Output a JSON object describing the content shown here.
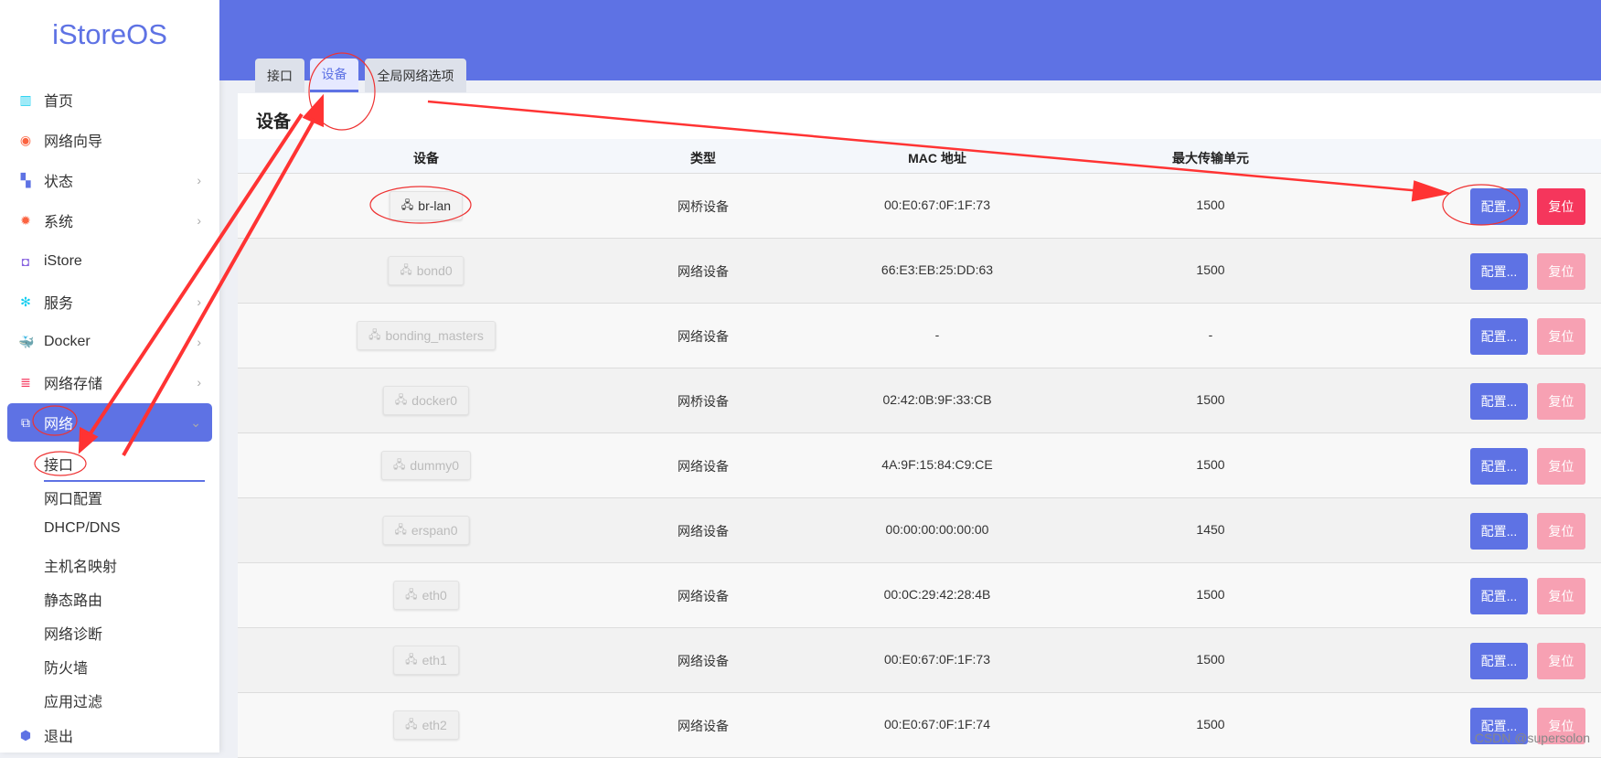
{
  "app": {
    "logo": "iStoreOS",
    "watermark": "CSDN @supersolon"
  },
  "sidebar": {
    "items": [
      {
        "label": "首页",
        "icon": "dashboard-icon",
        "chev": false
      },
      {
        "label": "网络向导",
        "icon": "globe-icon",
        "chev": false
      },
      {
        "label": "状态",
        "icon": "grid-icon",
        "chev": true
      },
      {
        "label": "系统",
        "icon": "gear-icon",
        "chev": true
      },
      {
        "label": "iStore",
        "icon": "bag-icon",
        "chev": false
      },
      {
        "label": "服务",
        "icon": "cogs-icon",
        "chev": true
      },
      {
        "label": "Docker",
        "icon": "docker-icon",
        "chev": true
      },
      {
        "label": "网络存储",
        "icon": "database-icon",
        "chev": true
      },
      {
        "label": "网络",
        "icon": "sitemap-icon",
        "chev": true
      }
    ],
    "subitems": [
      "接口",
      "网口配置",
      "DHCP/DNS",
      "主机名映射",
      "静态路由",
      "网络诊断",
      "防火墙",
      "应用过滤"
    ],
    "logout": "退出"
  },
  "tabs": [
    "接口",
    "设备",
    "全局网络选项"
  ],
  "card": {
    "title": "设备",
    "columns": [
      "设备",
      "类型",
      "MAC 地址",
      "最大传输单元"
    ],
    "config_label": "配置...",
    "reset_label": "复位",
    "rows": [
      {
        "device": "br-lan",
        "type": "网桥设备",
        "mac": "00:E0:67:0F:1F:73",
        "mtu": "1500",
        "up": true
      },
      {
        "device": "bond0",
        "type": "网络设备",
        "mac": "66:E3:EB:25:DD:63",
        "mtu": "1500",
        "up": false
      },
      {
        "device": "bonding_masters",
        "type": "网络设备",
        "mac": "-",
        "mtu": "-",
        "up": false
      },
      {
        "device": "docker0",
        "type": "网桥设备",
        "mac": "02:42:0B:9F:33:CB",
        "mtu": "1500",
        "up": false
      },
      {
        "device": "dummy0",
        "type": "网络设备",
        "mac": "4A:9F:15:84:C9:CE",
        "mtu": "1500",
        "up": false
      },
      {
        "device": "erspan0",
        "type": "网络设备",
        "mac": "00:00:00:00:00:00",
        "mtu": "1450",
        "up": false
      },
      {
        "device": "eth0",
        "type": "网络设备",
        "mac": "00:0C:29:42:28:4B",
        "mtu": "1500",
        "up": false
      },
      {
        "device": "eth1",
        "type": "网络设备",
        "mac": "00:E0:67:0F:1F:73",
        "mtu": "1500",
        "up": false
      },
      {
        "device": "eth2",
        "type": "网络设备",
        "mac": "00:E0:67:0F:1F:74",
        "mtu": "1500",
        "up": false
      }
    ]
  }
}
